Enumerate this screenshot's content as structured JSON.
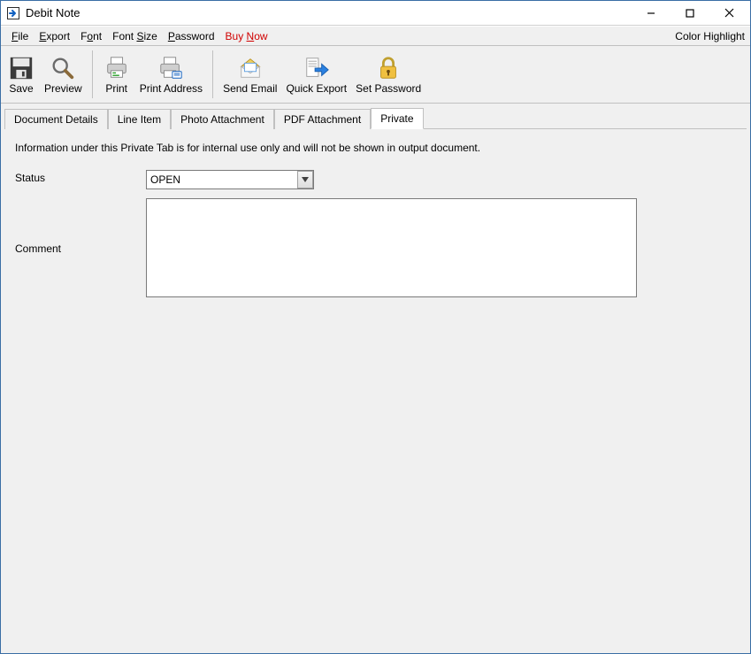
{
  "window": {
    "title": "Debit Note"
  },
  "menu": {
    "file": "File",
    "export": "Export",
    "font": "Font",
    "fontsize": "Font Size",
    "password": "Password",
    "buynow": "Buy Now",
    "colorhighlight": "Color Highlight"
  },
  "toolbar": {
    "save": "Save",
    "preview": "Preview",
    "print": "Print",
    "printaddress": "Print Address",
    "sendemail": "Send Email",
    "quickexport": "Quick Export",
    "setpassword": "Set Password"
  },
  "tabs": {
    "docdetails": "Document Details",
    "lineitem": "Line Item",
    "photo": "Photo Attachment",
    "pdf": "PDF Attachment",
    "private": "Private"
  },
  "private": {
    "info": "Information under this Private Tab is for internal use only and will not be shown in output document.",
    "status_label": "Status",
    "status_value": "OPEN",
    "comment_label": "Comment",
    "comment_value": ""
  }
}
